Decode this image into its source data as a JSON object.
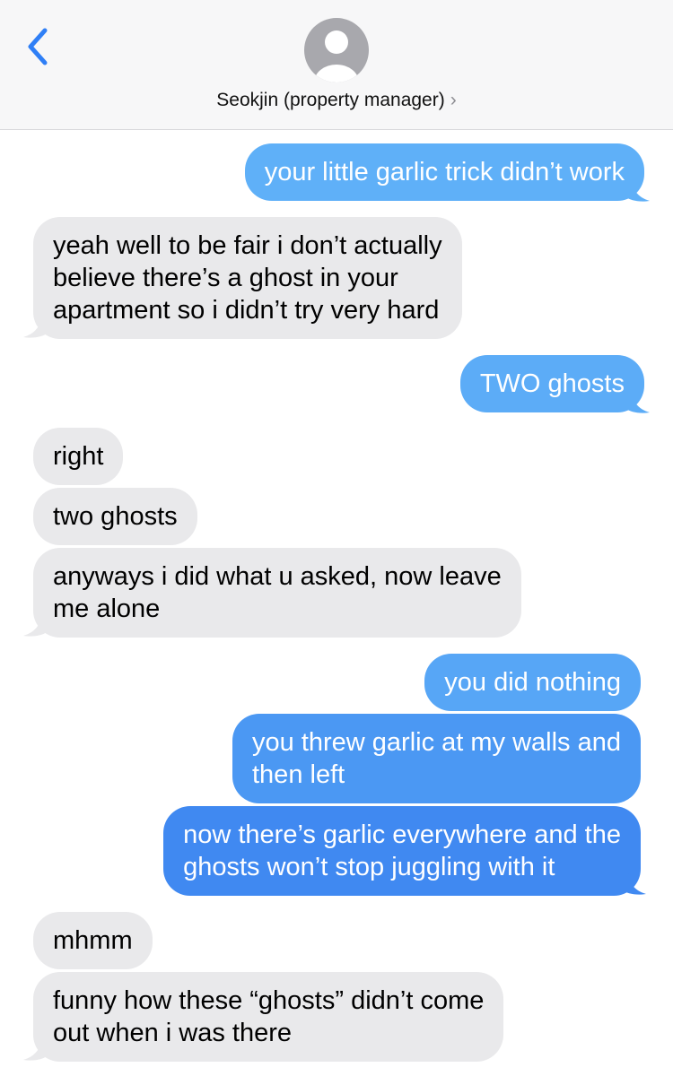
{
  "header": {
    "back_icon": "chevron-left-icon",
    "avatar_icon": "person-silhouette-icon",
    "contact_name": "Seokjin (property manager)",
    "chevron": "›"
  },
  "colors": {
    "sent_light": "#5fb0f8",
    "sent_dark": "#3f86f0",
    "received": "#e9e9eb",
    "ios_blue": "#2f7ff6"
  },
  "messages": [
    {
      "from": "me",
      "text": "your little garlic trick didn’t work"
    },
    {
      "from": "them",
      "text": "yeah well to be fair i don’t actually\nbelieve there’s a ghost in your\napartment so i didn’t try very hard"
    },
    {
      "from": "me",
      "text": "TWO ghosts"
    },
    {
      "from": "them",
      "text": "right"
    },
    {
      "from": "them",
      "text": "two ghosts"
    },
    {
      "from": "them",
      "text": "anyways i did what u asked, now leave\nme alone"
    },
    {
      "from": "me",
      "text": "you did nothing"
    },
    {
      "from": "me",
      "text": "you threw garlic at my walls and\nthen left"
    },
    {
      "from": "me",
      "text": "now there’s garlic everywhere and the\nghosts won’t stop juggling with it"
    },
    {
      "from": "them",
      "text": "mhmm"
    },
    {
      "from": "them",
      "text": "funny how these “ghosts” didn’t come\nout when i was there"
    }
  ]
}
